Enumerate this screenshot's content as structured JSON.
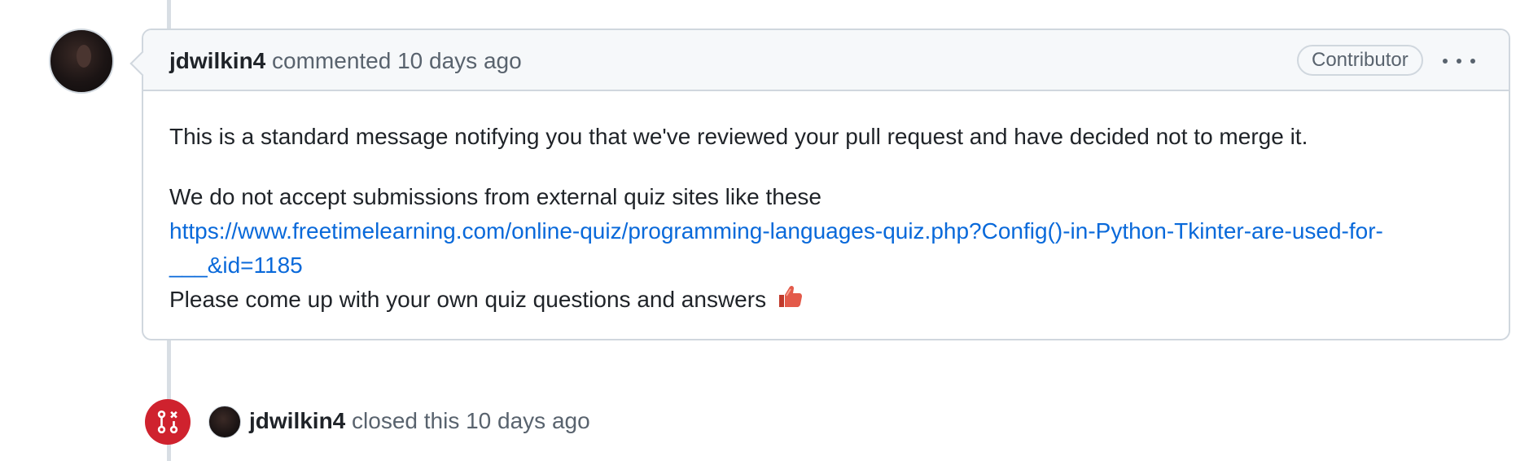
{
  "comment": {
    "author": "jdwilkin4",
    "action": "commented",
    "time": "10 days ago",
    "badge": "Contributor",
    "menu_icon": "kebab-horizontal-icon",
    "body": {
      "line1": "This is a standard message notifying you that we've reviewed your pull request and have decided not to merge it.",
      "line2": "We do not accept submissions from external quiz sites like these",
      "link_part1": "https://www.freetimelearning.com/online-quiz/programming-languages-quiz.php?Config()-in-Python-Tkinter-are-used-for-",
      "link_part2": "___&id=1185",
      "line3": "Please come up with your own quiz questions and answers",
      "emoji_icon": "thumbs-up-icon"
    }
  },
  "event": {
    "icon": "git-pull-request-closed-icon",
    "icon_color": "#cf222e",
    "author": "jdwilkin4",
    "action": "closed this",
    "time": "10 days ago"
  },
  "colors": {
    "link": "#0969da",
    "muted": "#59636e",
    "border": "#d0d7de",
    "header_bg": "#f6f8fa"
  }
}
